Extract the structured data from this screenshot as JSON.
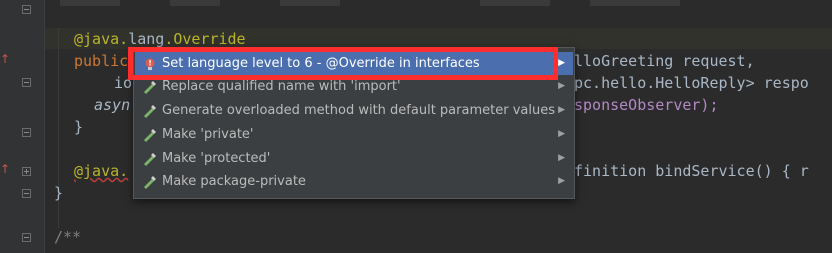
{
  "editor": {
    "lines": [
      {
        "segments": [
          {
            "cls": "anno",
            "text": "@java."
          },
          {
            "cls": "anno",
            "text": "lang"
          },
          {
            "cls": "anno",
            "text": ".Override"
          }
        ]
      },
      {
        "segments": [
          {
            "cls": "kw",
            "text": "public"
          }
        ]
      },
      {
        "segments": [
          {
            "cls": "",
            "text": "io"
          }
        ]
      },
      {
        "segments": [
          {
            "cls": "",
            "text": "asyn"
          }
        ]
      },
      {
        "segments": [
          {
            "cls": "",
            "text": "}"
          }
        ]
      },
      {
        "segments": [
          {
            "cls": "anno",
            "text": "@java."
          }
        ]
      },
      {
        "segments": [
          {
            "cls": "",
            "text": "}"
          }
        ]
      },
      {
        "segments": [
          {
            "cls": "comment",
            "text": "/**"
          }
        ]
      }
    ],
    "right_fragments": [
      {
        "text": "lloGreeting request,"
      },
      {
        "text": "pc.hello.HelloReply> respo"
      },
      {
        "text": "sponseObserver);"
      },
      {
        "text": "finition bindService() { r"
      }
    ]
  },
  "popup": {
    "items": [
      {
        "label": "Set language level to 6 - @Override in interfaces",
        "icon": "bulb-error-icon",
        "selected": true
      },
      {
        "label": "Replace qualified name with 'import'",
        "icon": "intention-icon",
        "selected": false
      },
      {
        "label": "Generate overloaded method with default parameter values",
        "icon": "intention-icon",
        "selected": false
      },
      {
        "label": "Make 'private'",
        "icon": "intention-icon",
        "selected": false
      },
      {
        "label": "Make 'protected'",
        "icon": "intention-icon",
        "selected": false
      },
      {
        "label": "Make package-private",
        "icon": "intention-icon",
        "selected": false
      }
    ],
    "submenu_arrow": "▶"
  },
  "colors": {
    "background": "#2b2b2b",
    "popup_bg": "#3c3f41",
    "selection": "#4b6eaf",
    "annotation": "#bbb529",
    "keyword": "#cc7832",
    "highlight_frame": "#ff2d2d"
  }
}
